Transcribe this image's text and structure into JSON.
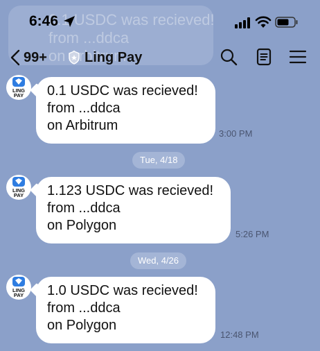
{
  "status": {
    "time": "6:46"
  },
  "ghost_notification": {
    "line1": "0.1 USDC was recieved!",
    "line2": "from ...ddca",
    "line3": "on Arbitrum"
  },
  "nav": {
    "back_count": "99+",
    "title": "Ling Pay"
  },
  "avatar_text": "LING PAY",
  "messages": [
    {
      "line1": "0.1 USDC was recieved!",
      "line2": "from ...ddca",
      "line3": "on Arbitrum",
      "time": "3:00 PM"
    },
    {
      "line1": "1.123 USDC was recieved!",
      "line2": "from ...ddca",
      "line3": "on Polygon",
      "time": "5:26 PM"
    },
    {
      "line1": "1.0 USDC was recieved!",
      "line2": "from ...ddca",
      "line3": "on Polygon",
      "time": "12:48 PM"
    }
  ],
  "dates": [
    "Tue, 4/18",
    "Wed, 4/26"
  ],
  "icons": {
    "back": "chevron-left-icon",
    "verified": "shield-icon",
    "search": "search-icon",
    "notes": "notes-icon",
    "menu": "menu-icon"
  },
  "colors": {
    "background": "#8ba0c9",
    "bubble": "#ffffff",
    "date_chip": "#a4b5d6",
    "brand": "#2f7de1"
  }
}
